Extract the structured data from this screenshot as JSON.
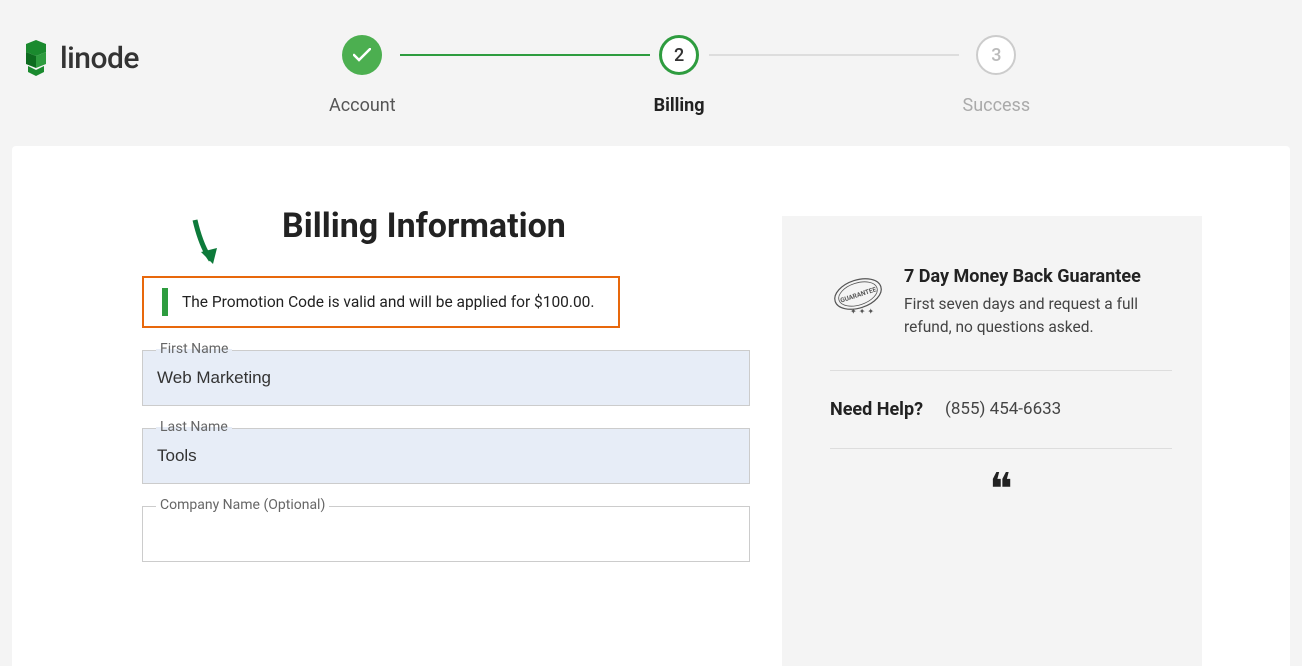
{
  "brand": {
    "name": "linode"
  },
  "stepper": {
    "steps": [
      {
        "label": "Account",
        "status": "done"
      },
      {
        "label": "Billing",
        "status": "active",
        "number": "2"
      },
      {
        "label": "Success",
        "status": "inactive",
        "number": "3"
      }
    ]
  },
  "page": {
    "title": "Billing Information"
  },
  "promo": {
    "message": "The Promotion Code is valid and will be applied for $100.00."
  },
  "form": {
    "first_name": {
      "label": "First Name",
      "value": "Web Marketing"
    },
    "last_name": {
      "label": "Last Name",
      "value": "Tools"
    },
    "company": {
      "label": "Company Name (Optional)",
      "value": ""
    }
  },
  "sidebar": {
    "guarantee": {
      "title": "7 Day Money Back Guarantee",
      "desc": "First seven days and request a full refund, no questions asked."
    },
    "help": {
      "label": "Need Help?",
      "phone": "(855) 454-6633"
    }
  }
}
